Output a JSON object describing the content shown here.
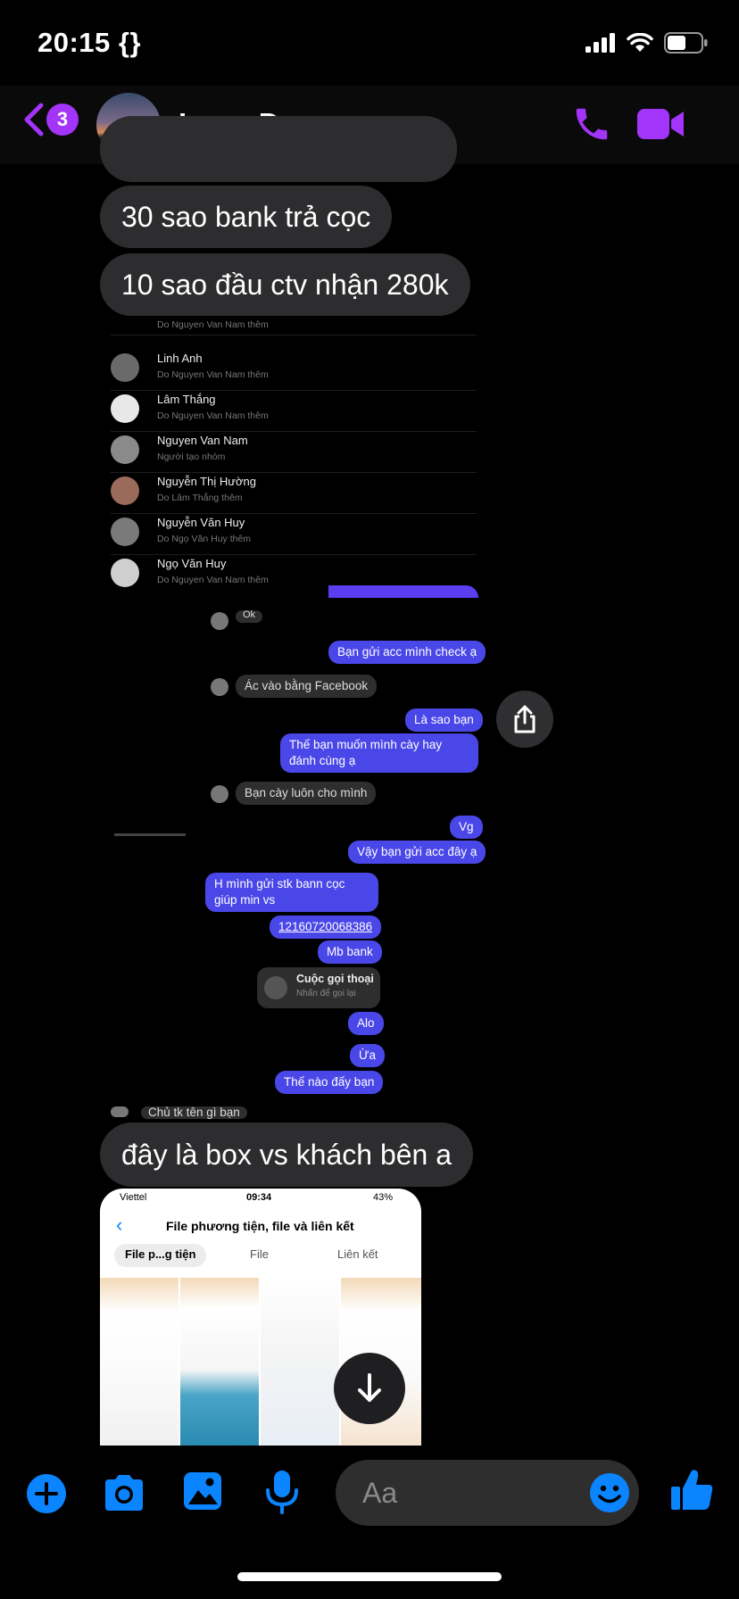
{
  "status_bar": {
    "time": "20:15 {}"
  },
  "header": {
    "back_badge": "3",
    "contact_name": "Long Đen"
  },
  "messages": {
    "m1": "30 sao bank trả cọc",
    "m2": "10 sao đầu ctv nhận 280k",
    "m3": "đây là box vs khách bên a"
  },
  "shared_image": {
    "members": [
      {
        "name": "Linh Anh",
        "sub": "Do Nguyen Van Nam thêm"
      },
      {
        "name": "Lâm Thắng",
        "sub": "Do Nguyen Van Nam thêm"
      },
      {
        "name": "Nguyen Van Nam",
        "sub": "Người tạo nhóm"
      },
      {
        "name": "Nguyễn Thị Hường",
        "sub": "Do Lâm Thắng thêm"
      },
      {
        "name": "Nguyễn Văn Huy",
        "sub": "Do Ngọ Văn Huy thêm"
      },
      {
        "name": "Ngọ Văn Huy",
        "sub": "Do Nguyen Van Nam thêm"
      }
    ],
    "chat": {
      "c1": "Ok",
      "c2": "Bạn gửi acc mình check ạ",
      "c3": "Ác vào bằng Facebook",
      "c4": "Là sao bạn",
      "c5": "Thế bạn muốn mình cày hay đánh cùng ạ",
      "c6": "Bạn cày luôn cho mình",
      "c7": "Vg",
      "c8": "Vậy bạn gửi acc đây ạ",
      "c9": "H mình gửi stk bann cọc giúp min vs",
      "c10": "12160720068386",
      "c11": "Mb bank",
      "call_title": "Cuộc gọi thoại",
      "call_sub": "Nhấn để gọi lại",
      "c12": "Alo",
      "c13": "Ừa",
      "c14": "Thế nào đấy bạn",
      "c15": "Chủ tk tên gì bạn"
    }
  },
  "media_screenshot": {
    "carrier": "Viettel",
    "time": "09:34",
    "battery": "43%",
    "title": "File phương tiện, file và liên kết",
    "tabs": [
      "File p...g tiện",
      "File",
      "Liên kết"
    ]
  },
  "composer": {
    "placeholder": "Aa"
  },
  "colors": {
    "accent": "#a334fa",
    "blue": "#0a84ff",
    "bubble_in": "#2d2d2f",
    "bubble_out": "#4a47e8"
  }
}
